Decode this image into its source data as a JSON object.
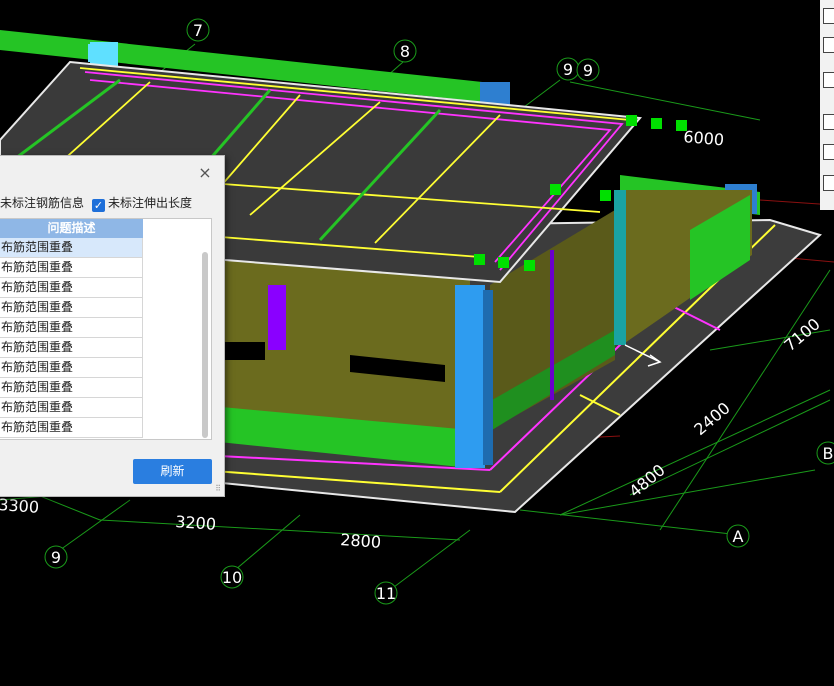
{
  "grid_labels": {
    "axis_7": "7",
    "axis_8": "8",
    "axis_9_top_a": "9",
    "axis_9_top_b": "9",
    "axis_9_bottom": "9",
    "axis_10": "10",
    "axis_11": "11",
    "axis_A": "A",
    "axis_B": "B"
  },
  "dimensions": {
    "d6000": "6000",
    "d7100": "7100",
    "d2400": "2400",
    "d4800": "4800",
    "d3300": "3300",
    "d3200": "3200",
    "d2800": "2800"
  },
  "dialog": {
    "option_1": "未标注钢筋信息",
    "option_2": "未标注伸出长度",
    "column_header": "问题描述",
    "rows": [
      "布筋范围重叠",
      "布筋范围重叠",
      "布筋范围重叠",
      "布筋范围重叠",
      "布筋范围重叠",
      "布筋范围重叠",
      "布筋范围重叠",
      "布筋范围重叠",
      "布筋范围重叠",
      "布筋范围重叠"
    ],
    "refresh_label": "刷新",
    "close_glyph": "×"
  },
  "right_toolbar": {
    "icons": [
      "toolbar-icon",
      "checkbox-icon",
      "checkbox-icon",
      "checkbox-icon",
      "checkbox-icon",
      "checkbox-icon",
      "checkbox-icon"
    ]
  },
  "colors": {
    "background": "#000000",
    "slab": "#3c3c3c",
    "beam_green": "#25c425",
    "wall_olive": "#6b6b1e",
    "column_blue": "#2e9cf0",
    "rebar_yellow": "#ffff33",
    "rebar_magenta": "#ff33ff",
    "accent_blue": "#2a7ee0"
  }
}
